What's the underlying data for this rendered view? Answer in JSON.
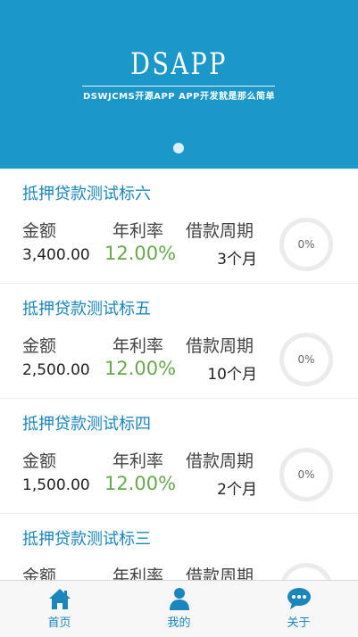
{
  "banner": {
    "title": "DSAPP",
    "subtitle": "DSWJCMS开源APP APP开发就是那么简单"
  },
  "columns": {
    "amount_label": "金额",
    "rate_label": "年利率",
    "period_label": "借款周期"
  },
  "loans": [
    {
      "title": "抵押贷款测试标六",
      "amount": "3,400.00",
      "rate": "12.00%",
      "period": "3个月",
      "progress": "0%"
    },
    {
      "title": "抵押贷款测试标五",
      "amount": "2,500.00",
      "rate": "12.00%",
      "period": "10个月",
      "progress": "0%"
    },
    {
      "title": "抵押贷款测试标四",
      "amount": "1,500.00",
      "rate": "12.00%",
      "period": "2个月",
      "progress": "0%"
    },
    {
      "title": "抵押贷款测试标三",
      "amount": "",
      "rate": "",
      "period": "",
      "progress": ""
    }
  ],
  "tabs": [
    {
      "label": "首页",
      "icon": "home-icon"
    },
    {
      "label": "我的",
      "icon": "user-icon"
    },
    {
      "label": "关于",
      "icon": "chat-icon"
    }
  ],
  "colors": {
    "brand": "#1b98c9",
    "link": "#1b86bb",
    "rate": "#6aa84f"
  }
}
